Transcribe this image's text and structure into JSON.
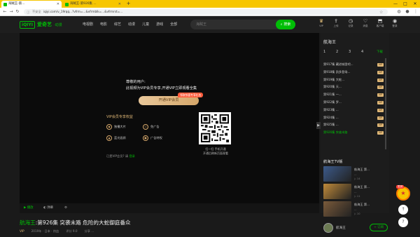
{
  "browser": {
    "tabs": [
      {
        "label": "海贼王-第..."
      },
      {
        "label": "海贼王-第926集 ..."
      }
    ],
    "new_tab": "+",
    "window_controls": {
      "minimize": "—",
      "maximize": "□",
      "close": "✕"
    },
    "address_warning": "不安全",
    "url": "iqiyi.com/v_19rqq...?vfrm=...&vfrmblk=...&vfrmrst=...",
    "nav": {
      "back": "←",
      "forward": "→",
      "reload": "↻"
    }
  },
  "site": {
    "logo_mark": "iQIYI",
    "logo_text": "爱奇艺",
    "logo_sub": "·动漫",
    "nav": [
      "电视剧",
      "电影",
      "综艺",
      "动漫",
      "儿童",
      "游戏",
      "全部"
    ],
    "search_placeholder": "海贼王",
    "search_button": "搜索",
    "header_icons": [
      {
        "glyph": "♛",
        "label": "VIP"
      },
      {
        "glyph": "⇪",
        "label": "上传"
      },
      {
        "glyph": "◷",
        "label": "记录"
      },
      {
        "glyph": "♡",
        "label": "消息"
      },
      {
        "glyph": "⬒",
        "label": "客户端"
      },
      {
        "glyph": "◉",
        "label": "登录"
      }
    ]
  },
  "player": {
    "vip_title": "尊敬的用户:",
    "vip_desc": "此视频为VIP会员专享,开通VIP立即观看全集",
    "open_vip_button": "开通VIP会员",
    "vip_ribbon": "领取惊喜专享礼包",
    "benefits_title": "VIP会员专享权益",
    "benefits": [
      {
        "icon": "◆",
        "label": "独播大片"
      },
      {
        "icon": "◇",
        "label": "免广告"
      },
      {
        "icon": "▲",
        "label": "蓝光画质"
      },
      {
        "icon": "●",
        "label": "广告特权"
      }
    ],
    "has_vip_text": "已是VIP会员? 请",
    "login_link": "登录",
    "qr_caption": "扫一扫 手机开通\n开通后刷新页面观看",
    "side_toggle": "▶",
    "controls": [
      {
        "label": "▶ 播放",
        "green": true
      },
      {
        "label": "◐ 弹幕",
        "green": false
      },
      {
        "label": "⚙",
        "green": false
      }
    ]
  },
  "video": {
    "series": "航海王",
    "title": ":第926集 突袭末路 危险的大蛇御庭番众",
    "meta": [
      "VIP",
      "2019年 · 日本 · 热血",
      "评分 9.0",
      "分享 ..."
    ]
  },
  "episodes": {
    "title": "航海王",
    "tabs": [
      "1",
      "2",
      "3",
      "4",
      "下载"
    ],
    "list": [
      {
        "label": "第917集 藏进城里吧...",
        "badge": "VIP",
        "current": false
      },
      {
        "label": "第918集 凯多登场...",
        "badge": "VIP",
        "current": false
      },
      {
        "label": "第919集 大蛇...",
        "badge": "VIP",
        "current": false
      },
      {
        "label": "第920集 天...",
        "badge": "VIP",
        "current": false
      },
      {
        "label": "第921集 一...",
        "badge": "VIP",
        "current": false
      },
      {
        "label": "第922集 罗...",
        "badge": "VIP",
        "current": false
      },
      {
        "label": "第923集 ...",
        "badge": "VIP",
        "current": false
      },
      {
        "label": "第924集 ...",
        "badge": "VIP",
        "current": false
      },
      {
        "label": "第925集 ...",
        "badge": "VIP",
        "current": false
      },
      {
        "label": "第926集 突袭末路",
        "badge": "VIP",
        "current": true
      }
    ]
  },
  "related": {
    "title": "航海王TV版",
    "items": [
      {
        "name": "航海王 第...",
        "desc": "...",
        "count": "▷ 14",
        "color": "#3c5a8a"
      },
      {
        "name": "航海王 第...",
        "desc": "...",
        "count": "▷ 11",
        "color": "#c08a3a"
      },
      {
        "name": "航海王 第...",
        "desc": "...",
        "count": "▷ 10",
        "color": "#7a5a3a"
      }
    ]
  },
  "uploader": {
    "name": "航海王",
    "follow": "+ 订阅"
  },
  "floating": {
    "gift_glyph": "★",
    "gift_tag": "签到",
    "top_button": "↑",
    "feedback_button": "?"
  }
}
